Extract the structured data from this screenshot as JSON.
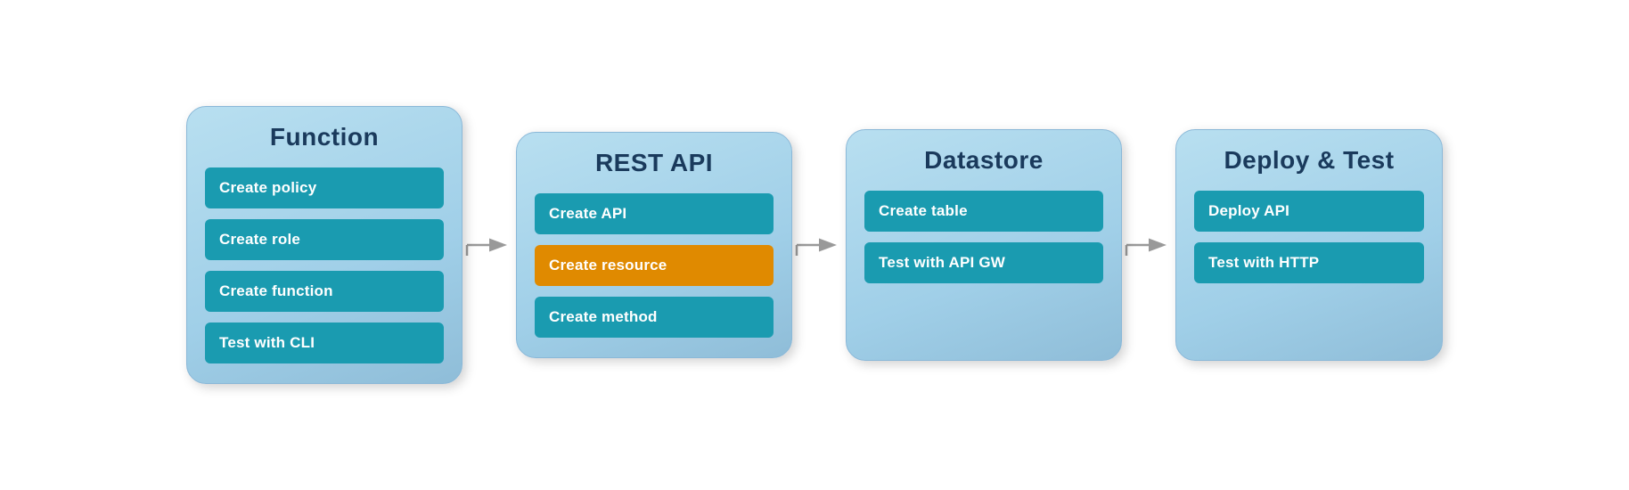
{
  "panels": [
    {
      "id": "function",
      "title": "Function",
      "buttons": [
        {
          "id": "create-policy",
          "label": "Create policy",
          "style": "teal"
        },
        {
          "id": "create-role",
          "label": "Create role",
          "style": "teal"
        },
        {
          "id": "create-function",
          "label": "Create function",
          "style": "teal"
        },
        {
          "id": "test-cli",
          "label": "Test with CLI",
          "style": "teal"
        }
      ]
    },
    {
      "id": "rest-api",
      "title": "REST API",
      "buttons": [
        {
          "id": "create-api",
          "label": "Create API",
          "style": "teal"
        },
        {
          "id": "create-resource",
          "label": "Create resource",
          "style": "orange"
        },
        {
          "id": "create-method",
          "label": "Create method",
          "style": "teal"
        }
      ]
    },
    {
      "id": "datastore",
      "title": "Datastore",
      "buttons": [
        {
          "id": "create-table",
          "label": "Create table",
          "style": "teal"
        },
        {
          "id": "test-api-gw",
          "label": "Test with API GW",
          "style": "teal"
        }
      ]
    },
    {
      "id": "deploy-test",
      "title": "Deploy & Test",
      "buttons": [
        {
          "id": "deploy-api",
          "label": "Deploy API",
          "style": "teal"
        },
        {
          "id": "test-http",
          "label": "Test with HTTP",
          "style": "teal"
        }
      ]
    }
  ],
  "arrows": [
    {
      "id": "arrow-1"
    },
    {
      "id": "arrow-2"
    },
    {
      "id": "arrow-3"
    }
  ]
}
